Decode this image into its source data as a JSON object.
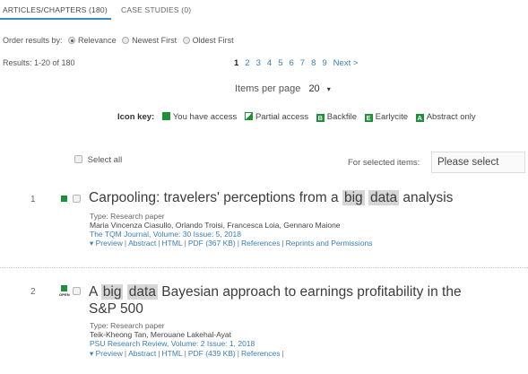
{
  "tabs": [
    {
      "label": "ARTICLES/CHAPTERS (180)",
      "active": true
    },
    {
      "label": "CASE STUDIES (0)",
      "active": false
    }
  ],
  "order": {
    "label": "Order results by:",
    "options": [
      {
        "label": "Relevance",
        "selected": true
      },
      {
        "label": "Newest First",
        "selected": false
      },
      {
        "label": "Oldest First",
        "selected": false
      }
    ]
  },
  "results_text": "Results: 1-20 of 180",
  "pagination": {
    "pages": [
      "1",
      "2",
      "3",
      "4",
      "5",
      "6",
      "7",
      "8",
      "9"
    ],
    "current": "1",
    "next_label": "Next >"
  },
  "items_per_page": {
    "label": "Items per page",
    "value": "20",
    "chevron": "▾"
  },
  "icon_key": {
    "label": "Icon key:",
    "entries": [
      {
        "icon": "green-square",
        "glyph": "",
        "label": "You have access"
      },
      {
        "icon": "partial-access",
        "glyph": "",
        "label": "Partial access"
      },
      {
        "icon": "letter-b",
        "glyph": "B",
        "label": "Backfile"
      },
      {
        "icon": "letter-e",
        "glyph": "E",
        "label": "Earlycite"
      },
      {
        "icon": "letter-a",
        "glyph": "A",
        "label": "Abstract only"
      }
    ]
  },
  "select_all_label": "Select all",
  "for_selected": {
    "label": "For selected items:",
    "placeholder": "Please select"
  },
  "results": [
    {
      "number": "1",
      "open_access": false,
      "title_parts": [
        {
          "text": "Carpooling: travelers' perceptions from a ",
          "hl": false
        },
        {
          "text": "big",
          "hl": true
        },
        {
          "text": " ",
          "hl": false
        },
        {
          "text": "data",
          "hl": true
        },
        {
          "text": " analysis",
          "hl": false
        }
      ],
      "type": "Type: Research paper",
      "authors": "Maria Vincenza Ciasullo, Orlando Troisi, Francesca Loia, Gennaro Maione",
      "source": "The TQM Journal, Volume: 30 Issue: 5, 2018",
      "links": [
        "▾ Preview",
        "Abstract",
        "HTML",
        "PDF (367 KB)",
        "References",
        "Reprints and Permissions"
      ]
    },
    {
      "number": "2",
      "open_access": true,
      "open_label": "OPEN",
      "title_parts": [
        {
          "text": "A ",
          "hl": false
        },
        {
          "text": "big",
          "hl": true
        },
        {
          "text": " ",
          "hl": false
        },
        {
          "text": "data",
          "hl": true
        },
        {
          "text": " Bayesian approach to earnings profitability in the",
          "hl": false
        }
      ],
      "title_line2": "S&P 500",
      "type": "Type: Research paper",
      "authors": "Teik-Kheong Tan, Merouane Lakehal-Ayat",
      "source": "PSU Research Review, Volume: 2 Issue: 1, 2018",
      "links": [
        "▾ Preview",
        "Abstract",
        "HTML",
        "PDF (439 KB)",
        "References"
      ],
      "trailing_sep": "|"
    }
  ],
  "colors": {
    "link": "#3a7fb8",
    "access_green": "#1f8f3a",
    "tab_underline": "#3a8bbf",
    "highlight": "#d6d6d6"
  }
}
